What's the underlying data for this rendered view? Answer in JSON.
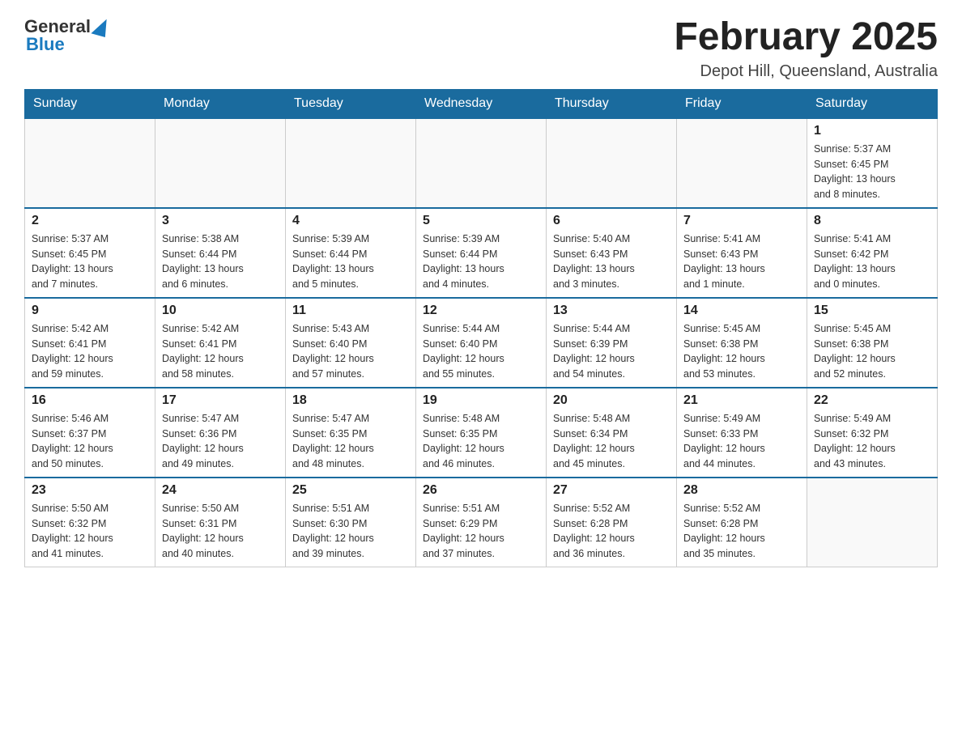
{
  "header": {
    "logo_general": "General",
    "logo_blue": "Blue",
    "title": "February 2025",
    "location": "Depot Hill, Queensland, Australia"
  },
  "weekdays": [
    "Sunday",
    "Monday",
    "Tuesday",
    "Wednesday",
    "Thursday",
    "Friday",
    "Saturday"
  ],
  "weeks": [
    [
      {
        "day": "",
        "info": ""
      },
      {
        "day": "",
        "info": ""
      },
      {
        "day": "",
        "info": ""
      },
      {
        "day": "",
        "info": ""
      },
      {
        "day": "",
        "info": ""
      },
      {
        "day": "",
        "info": ""
      },
      {
        "day": "1",
        "info": "Sunrise: 5:37 AM\nSunset: 6:45 PM\nDaylight: 13 hours\nand 8 minutes."
      }
    ],
    [
      {
        "day": "2",
        "info": "Sunrise: 5:37 AM\nSunset: 6:45 PM\nDaylight: 13 hours\nand 7 minutes."
      },
      {
        "day": "3",
        "info": "Sunrise: 5:38 AM\nSunset: 6:44 PM\nDaylight: 13 hours\nand 6 minutes."
      },
      {
        "day": "4",
        "info": "Sunrise: 5:39 AM\nSunset: 6:44 PM\nDaylight: 13 hours\nand 5 minutes."
      },
      {
        "day": "5",
        "info": "Sunrise: 5:39 AM\nSunset: 6:44 PM\nDaylight: 13 hours\nand 4 minutes."
      },
      {
        "day": "6",
        "info": "Sunrise: 5:40 AM\nSunset: 6:43 PM\nDaylight: 13 hours\nand 3 minutes."
      },
      {
        "day": "7",
        "info": "Sunrise: 5:41 AM\nSunset: 6:43 PM\nDaylight: 13 hours\nand 1 minute."
      },
      {
        "day": "8",
        "info": "Sunrise: 5:41 AM\nSunset: 6:42 PM\nDaylight: 13 hours\nand 0 minutes."
      }
    ],
    [
      {
        "day": "9",
        "info": "Sunrise: 5:42 AM\nSunset: 6:41 PM\nDaylight: 12 hours\nand 59 minutes."
      },
      {
        "day": "10",
        "info": "Sunrise: 5:42 AM\nSunset: 6:41 PM\nDaylight: 12 hours\nand 58 minutes."
      },
      {
        "day": "11",
        "info": "Sunrise: 5:43 AM\nSunset: 6:40 PM\nDaylight: 12 hours\nand 57 minutes."
      },
      {
        "day": "12",
        "info": "Sunrise: 5:44 AM\nSunset: 6:40 PM\nDaylight: 12 hours\nand 55 minutes."
      },
      {
        "day": "13",
        "info": "Sunrise: 5:44 AM\nSunset: 6:39 PM\nDaylight: 12 hours\nand 54 minutes."
      },
      {
        "day": "14",
        "info": "Sunrise: 5:45 AM\nSunset: 6:38 PM\nDaylight: 12 hours\nand 53 minutes."
      },
      {
        "day": "15",
        "info": "Sunrise: 5:45 AM\nSunset: 6:38 PM\nDaylight: 12 hours\nand 52 minutes."
      }
    ],
    [
      {
        "day": "16",
        "info": "Sunrise: 5:46 AM\nSunset: 6:37 PM\nDaylight: 12 hours\nand 50 minutes."
      },
      {
        "day": "17",
        "info": "Sunrise: 5:47 AM\nSunset: 6:36 PM\nDaylight: 12 hours\nand 49 minutes."
      },
      {
        "day": "18",
        "info": "Sunrise: 5:47 AM\nSunset: 6:35 PM\nDaylight: 12 hours\nand 48 minutes."
      },
      {
        "day": "19",
        "info": "Sunrise: 5:48 AM\nSunset: 6:35 PM\nDaylight: 12 hours\nand 46 minutes."
      },
      {
        "day": "20",
        "info": "Sunrise: 5:48 AM\nSunset: 6:34 PM\nDaylight: 12 hours\nand 45 minutes."
      },
      {
        "day": "21",
        "info": "Sunrise: 5:49 AM\nSunset: 6:33 PM\nDaylight: 12 hours\nand 44 minutes."
      },
      {
        "day": "22",
        "info": "Sunrise: 5:49 AM\nSunset: 6:32 PM\nDaylight: 12 hours\nand 43 minutes."
      }
    ],
    [
      {
        "day": "23",
        "info": "Sunrise: 5:50 AM\nSunset: 6:32 PM\nDaylight: 12 hours\nand 41 minutes."
      },
      {
        "day": "24",
        "info": "Sunrise: 5:50 AM\nSunset: 6:31 PM\nDaylight: 12 hours\nand 40 minutes."
      },
      {
        "day": "25",
        "info": "Sunrise: 5:51 AM\nSunset: 6:30 PM\nDaylight: 12 hours\nand 39 minutes."
      },
      {
        "day": "26",
        "info": "Sunrise: 5:51 AM\nSunset: 6:29 PM\nDaylight: 12 hours\nand 37 minutes."
      },
      {
        "day": "27",
        "info": "Sunrise: 5:52 AM\nSunset: 6:28 PM\nDaylight: 12 hours\nand 36 minutes."
      },
      {
        "day": "28",
        "info": "Sunrise: 5:52 AM\nSunset: 6:28 PM\nDaylight: 12 hours\nand 35 minutes."
      },
      {
        "day": "",
        "info": ""
      }
    ]
  ]
}
